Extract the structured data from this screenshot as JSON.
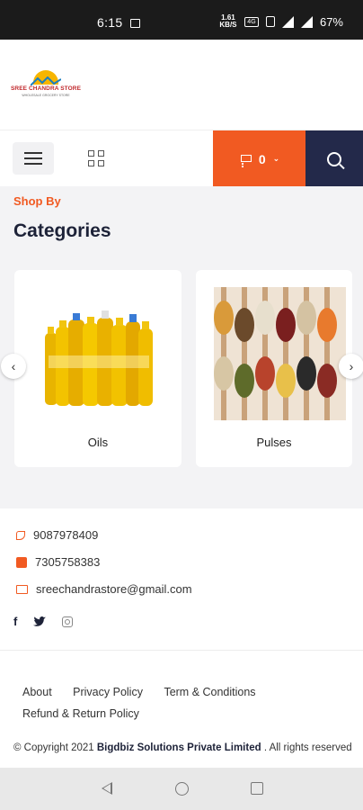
{
  "status_bar": {
    "time": "6:15",
    "data_speed": "1.61\nKB/S",
    "battery": "67%"
  },
  "brand": {
    "name": "SREE CHANDRA STORE",
    "tagline": "WHOLESALE GROCERY STORE"
  },
  "toolbar": {
    "cart_count": "0"
  },
  "categories_section": {
    "eyebrow": "Shop By",
    "title": "Categories",
    "items": [
      {
        "label": "Oils"
      },
      {
        "label": "Pulses"
      }
    ]
  },
  "contact": {
    "phone": "9087978409",
    "whatsapp": "7305758383",
    "email": "sreechandrastore@gmail.com"
  },
  "social": {
    "facebook": "f",
    "twitter": "t"
  },
  "footer_links": {
    "about": "About",
    "privacy": "Privacy Policy",
    "terms": "Term & Conditions",
    "refund": "Refund & Return Policy"
  },
  "copyright": {
    "prefix": "© Copyright 2021",
    "company": "Bigdbiz Solutions Private Limited",
    "suffix": ". All rights reserved"
  },
  "colors": {
    "accent": "#f15a22",
    "navy": "#23294a"
  }
}
